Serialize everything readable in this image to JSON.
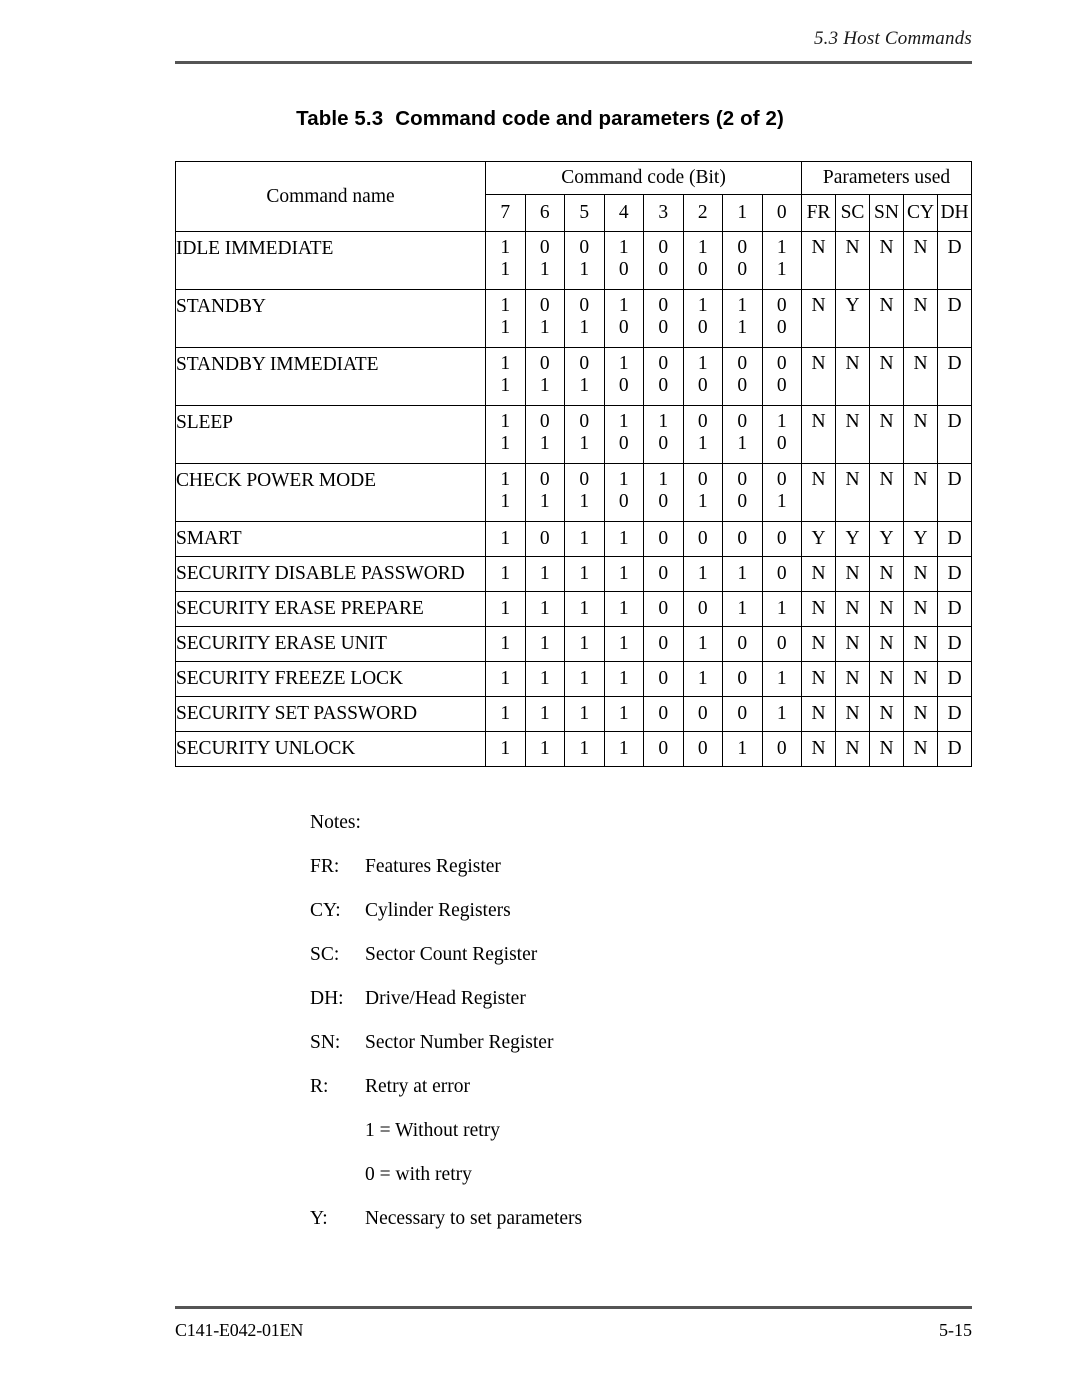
{
  "page": {
    "running_header": "5.3  Host Commands",
    "caption_prefix": "Table 5.3",
    "caption_text": "Command code and parameters (2 of 2)",
    "footer_doc_id": "C141-E042-01EN",
    "footer_page": "5-15"
  },
  "table": {
    "header": {
      "command_name": "Command name",
      "command_code_group": "Command code (Bit)",
      "parameters_group": "Parameters used",
      "bit_labels": [
        "7",
        "6",
        "5",
        "4",
        "3",
        "2",
        "1",
        "0"
      ],
      "param_labels": [
        "FR",
        "SC",
        "SN",
        "CY",
        "DH"
      ]
    },
    "rows": [
      {
        "name": "IDLE IMMEDIATE",
        "bits_line1": [
          "1",
          "0",
          "0",
          "1",
          "0",
          "1",
          "0",
          "1"
        ],
        "bits_line2": [
          "1",
          "1",
          "1",
          "0",
          "0",
          "0",
          "0",
          "1"
        ],
        "params": [
          "N",
          "N",
          "N",
          "N",
          "D"
        ]
      },
      {
        "name": "STANDBY",
        "bits_line1": [
          "1",
          "0",
          "0",
          "1",
          "0",
          "1",
          "1",
          "0"
        ],
        "bits_line2": [
          "1",
          "1",
          "1",
          "0",
          "0",
          "0",
          "1",
          "0"
        ],
        "params": [
          "N",
          "Y",
          "N",
          "N",
          "D"
        ]
      },
      {
        "name": "STANDBY IMMEDIATE",
        "bits_line1": [
          "1",
          "0",
          "0",
          "1",
          "0",
          "1",
          "0",
          "0"
        ],
        "bits_line2": [
          "1",
          "1",
          "1",
          "0",
          "0",
          "0",
          "0",
          "0"
        ],
        "params": [
          "N",
          "N",
          "N",
          "N",
          "D"
        ]
      },
      {
        "name": "SLEEP",
        "bits_line1": [
          "1",
          "0",
          "0",
          "1",
          "1",
          "0",
          "0",
          "1"
        ],
        "bits_line2": [
          "1",
          "1",
          "1",
          "0",
          "0",
          "1",
          "1",
          "0"
        ],
        "params": [
          "N",
          "N",
          "N",
          "N",
          "D"
        ]
      },
      {
        "name": "CHECK POWER MODE",
        "bits_line1": [
          "1",
          "0",
          "0",
          "1",
          "1",
          "0",
          "0",
          "0"
        ],
        "bits_line2": [
          "1",
          "1",
          "1",
          "0",
          "0",
          "1",
          "0",
          "1"
        ],
        "params": [
          "N",
          "N",
          "N",
          "N",
          "D"
        ]
      },
      {
        "name": "SMART",
        "bits_line1": [
          "1",
          "0",
          "1",
          "1",
          "0",
          "0",
          "0",
          "0"
        ],
        "bits_line2": null,
        "params": [
          "Y",
          "Y",
          "Y",
          "Y",
          "D"
        ]
      },
      {
        "name": "SECURITY DISABLE PASSWORD",
        "bits_line1": [
          "1",
          "1",
          "1",
          "1",
          "0",
          "1",
          "1",
          "0"
        ],
        "bits_line2": null,
        "params": [
          "N",
          "N",
          "N",
          "N",
          "D"
        ]
      },
      {
        "name": "SECURITY ERASE PREPARE",
        "bits_line1": [
          "1",
          "1",
          "1",
          "1",
          "0",
          "0",
          "1",
          "1"
        ],
        "bits_line2": null,
        "params": [
          "N",
          "N",
          "N",
          "N",
          "D"
        ]
      },
      {
        "name": "SECURITY ERASE UNIT",
        "bits_line1": [
          "1",
          "1",
          "1",
          "1",
          "0",
          "1",
          "0",
          "0"
        ],
        "bits_line2": null,
        "params": [
          "N",
          "N",
          "N",
          "N",
          "D"
        ]
      },
      {
        "name": "SECURITY FREEZE LOCK",
        "bits_line1": [
          "1",
          "1",
          "1",
          "1",
          "0",
          "1",
          "0",
          "1"
        ],
        "bits_line2": null,
        "params": [
          "N",
          "N",
          "N",
          "N",
          "D"
        ]
      },
      {
        "name": "SECURITY SET PASSWORD",
        "bits_line1": [
          "1",
          "1",
          "1",
          "1",
          "0",
          "0",
          "0",
          "1"
        ],
        "bits_line2": null,
        "params": [
          "N",
          "N",
          "N",
          "N",
          "D"
        ]
      },
      {
        "name": "SECURITY UNLOCK",
        "bits_line1": [
          "1",
          "1",
          "1",
          "1",
          "0",
          "0",
          "1",
          "0"
        ],
        "bits_line2": null,
        "params": [
          "N",
          "N",
          "N",
          "N",
          "D"
        ]
      }
    ]
  },
  "notes": {
    "title": "Notes:",
    "items": [
      {
        "key": "FR:",
        "value": "Features Register"
      },
      {
        "key": "CY:",
        "value": "Cylinder Registers"
      },
      {
        "key": "SC:",
        "value": "Sector Count Register"
      },
      {
        "key": "DH:",
        "value": "Drive/Head Register"
      },
      {
        "key": "SN:",
        "value": "Sector Number Register"
      },
      {
        "key": "R:",
        "value": "Retry at error"
      }
    ],
    "sub_items": [
      "1 =  Without retry",
      "0 = with retry"
    ],
    "last_item": {
      "key": "Y:",
      "value": "Necessary to set parameters"
    }
  }
}
